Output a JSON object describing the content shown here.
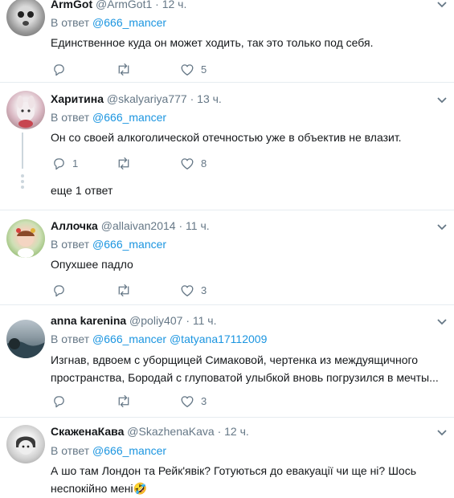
{
  "reply_prefix": "В ответ",
  "tweets": [
    {
      "name": "ArmGot",
      "handle": "@ArmGot1",
      "time": "12 ч.",
      "reply_to": "@666_mancer",
      "text": "Единственное куда он может ходить, так это только под себя.",
      "replies": "",
      "retweets": "",
      "likes": "5"
    },
    {
      "name": "Харитина",
      "handle": "@skalyariya777",
      "time": "13 ч.",
      "reply_to": "@666_mancer",
      "text": "Он со своей алкоголической отечностью уже в объектив не влазит.",
      "replies": "1",
      "retweets": "",
      "likes": "8",
      "more_replies": "еще 1 ответ"
    },
    {
      "name": "Аллочка",
      "handle": "@allaivan2014",
      "time": "11 ч.",
      "reply_to": "@666_mancer",
      "text": "Опухшее падло",
      "replies": "",
      "retweets": "",
      "likes": "3"
    },
    {
      "name": "anna karenina",
      "handle": "@poliy407",
      "time": "11 ч.",
      "reply_to": "@666_mancer",
      "reply_to_2": "@tatyana17112009",
      "text_line1": "Изгнав, вдвоем с уборщицей Симаковой, чертенка из междуящичного",
      "text_line2": "пространства, Бородай с глуповатой улыбкой вновь погрузился в мечты...",
      "replies": "",
      "retweets": "",
      "likes": "3"
    },
    {
      "name": "СкаженаКава",
      "handle": "@SkazhenaKava",
      "time": "12 ч.",
      "reply_to": "@666_mancer",
      "text_line1": "А шо там Лондон та Рейк'явік? Готуються до евакуації чи ще ні? Шось",
      "text_line2": "неспокійно мені🤣"
    }
  ],
  "colors": {
    "link": "#1b95e0",
    "muted": "#657786",
    "divider": "#e6ecf0",
    "text": "#14171a"
  },
  "icons": [
    "reply-icon",
    "retweet-icon",
    "like-icon",
    "chevron-down-icon"
  ]
}
